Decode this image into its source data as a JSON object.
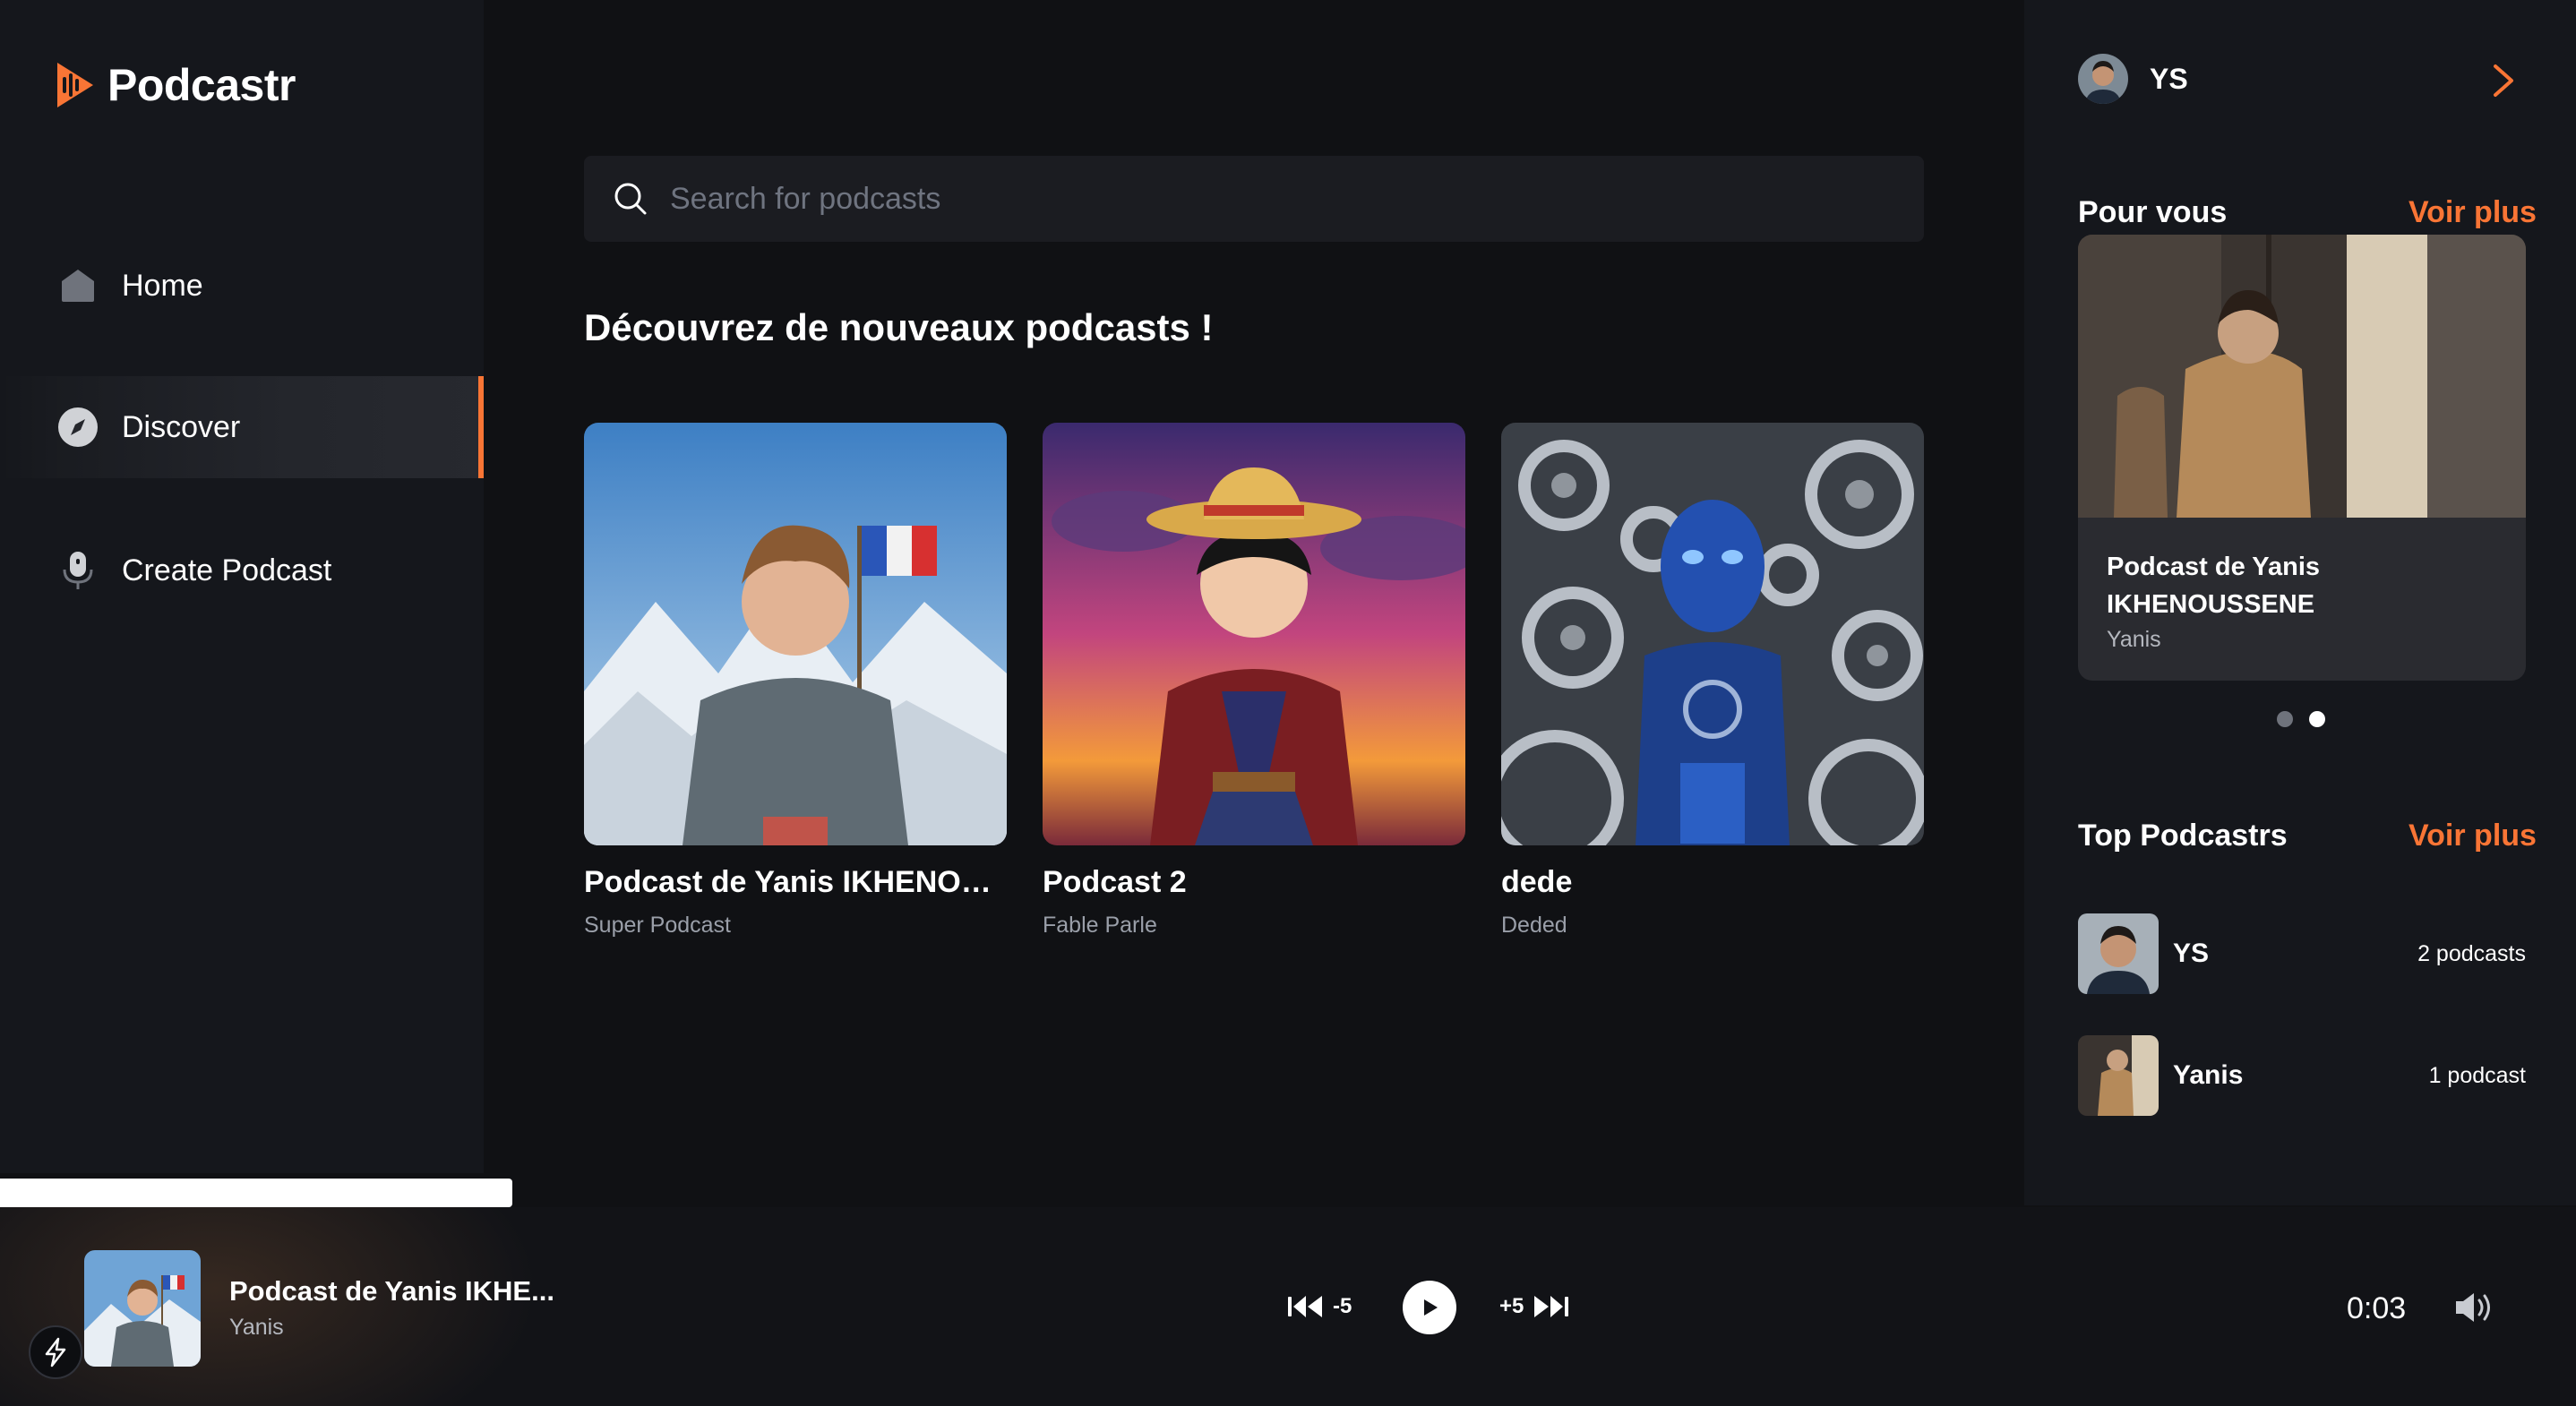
{
  "app": {
    "name": "Podcastr",
    "accent": "#f97535"
  },
  "nav": [
    {
      "label": "Home",
      "icon": "home-icon",
      "active": false
    },
    {
      "label": "Discover",
      "icon": "compass-icon",
      "active": true
    },
    {
      "label": "Create Podcast",
      "icon": "microphone-icon",
      "active": false
    }
  ],
  "search": {
    "placeholder": "Search for podcasts",
    "value": ""
  },
  "discover": {
    "title": "Découvrez de nouveaux podcasts !",
    "podcasts": [
      {
        "title": "Podcast de Yanis IKHENOUSSENE",
        "subtitle": "Super Podcast",
        "art": "man-with-french-flag-on-mountain"
      },
      {
        "title": "Podcast 2",
        "subtitle": "Fable Parle",
        "art": "anime-pirate-at-sunset"
      },
      {
        "title": "dede",
        "subtitle": "Deded",
        "art": "blue-robot-with-gears"
      }
    ]
  },
  "profile": {
    "initials": "YS"
  },
  "for_you": {
    "heading": "Pour vous",
    "more": "Voir plus",
    "featured": {
      "title": "Podcast de Yanis IKHENOUSSENE",
      "author": "Yanis"
    },
    "slides": 2,
    "active_slide": 2
  },
  "top_podcasters": {
    "heading": "Top Podcastrs",
    "more": "Voir plus",
    "items": [
      {
        "name": "YS",
        "count": "2 podcasts"
      },
      {
        "name": "Yanis",
        "count": "1 podcast"
      }
    ]
  },
  "player": {
    "title": "Podcast de Yanis IKHE...",
    "artist": "Yanis",
    "rewind_label": "-5",
    "forward_label": "+5",
    "time": "0:03",
    "progress": 0.199
  }
}
